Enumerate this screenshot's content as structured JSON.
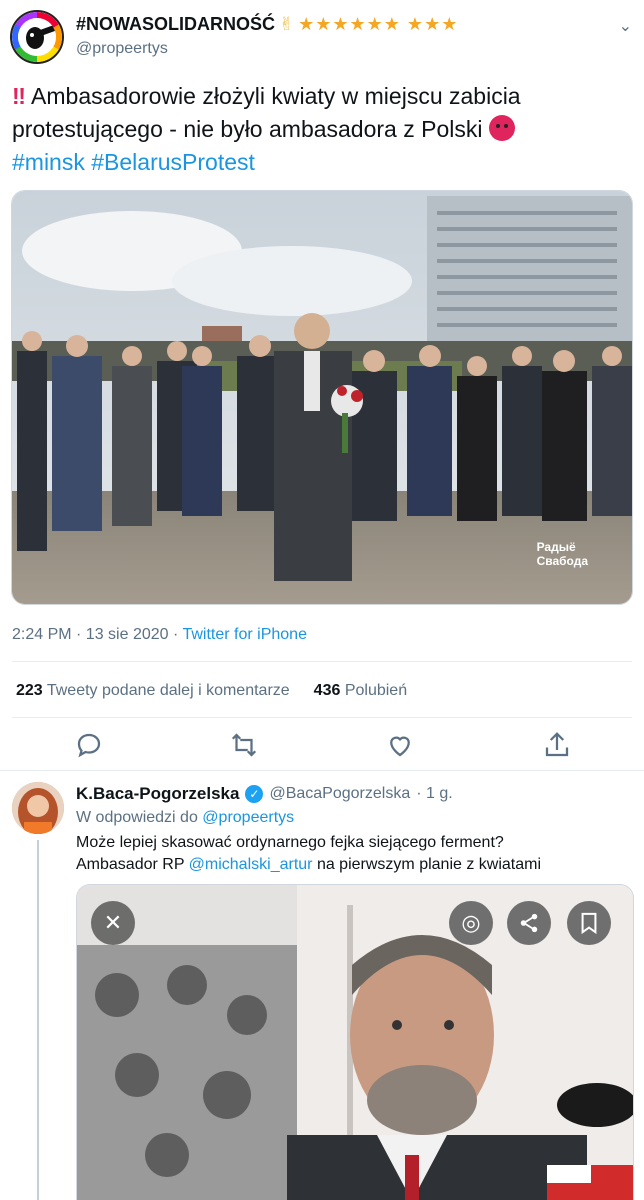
{
  "tweet": {
    "display_name": "#NOWASOLIDARNOŚĆ",
    "name_emoji": "✌",
    "stars": "★★★★★★ ★★★",
    "handle": "@propeertys",
    "alert_emoji": "‼",
    "text_main": "Ambasadorowie złożyli kwiaty w miejscu zabicia protestującego - nie było ambasadora z Polski",
    "hashtags": [
      "#minsk",
      "#BelarusProtest"
    ],
    "watermark_line1": "Радыё",
    "watermark_line2": "Свабода",
    "time": "2:24 PM · 13 sie 2020 ·",
    "source": "Twitter for iPhone",
    "retweets_count": "223",
    "retweets_label": "Tweety podane dalej i komentarze",
    "likes_count": "436",
    "likes_label": "Polubień"
  },
  "reply": {
    "display_name": "K.Baca-Pogorzelska",
    "handle": "@BacaPogorzelska",
    "time": "· 1 g.",
    "replying_prefix": "W odpowiedzi do",
    "replying_handle": "@propeertys",
    "text_line1": "Może lepiej skasować ordynarnego fejka siejącego ferment?",
    "text_line2_prefix": "Ambasador RP",
    "mention": "@michalski_artur",
    "text_line2_suffix": "na pierwszym planie z kwiatami"
  },
  "icons": {
    "reply": "reply-icon",
    "retweet": "retweet-icon",
    "like": "heart-icon",
    "share": "share-icon",
    "close": "close-icon",
    "lens": "lens-icon",
    "share_img": "share-icon",
    "bookmark": "bookmark-icon"
  },
  "colors": {
    "link": "#1b95e0",
    "muted": "#5b7083",
    "alert": "#e0245e",
    "star": "#f5a623"
  }
}
